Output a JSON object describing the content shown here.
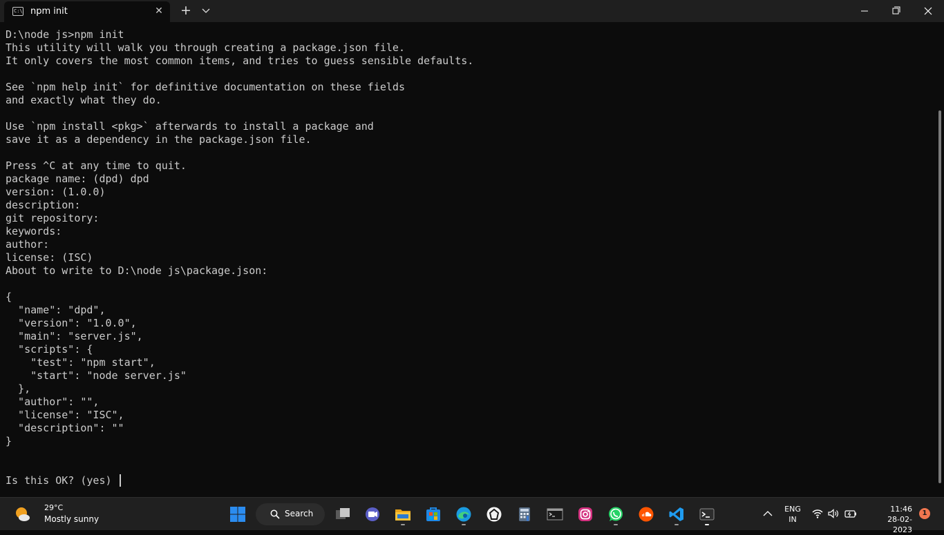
{
  "window": {
    "tab_title": "npm init",
    "tab_icon_text": "C:\\_",
    "close_tab_glyph": "✕",
    "new_tab_glyph": "+"
  },
  "terminal": {
    "lines": [
      "D:\\node js>npm init",
      "This utility will walk you through creating a package.json file.",
      "It only covers the most common items, and tries to guess sensible defaults.",
      "",
      "See `npm help init` for definitive documentation on these fields",
      "and exactly what they do.",
      "",
      "Use `npm install <pkg>` afterwards to install a package and",
      "save it as a dependency in the package.json file.",
      "",
      "Press ^C at any time to quit.",
      "package name: (dpd) dpd",
      "version: (1.0.0)",
      "description:",
      "git repository:",
      "keywords:",
      "author:",
      "license: (ISC)",
      "About to write to D:\\node js\\package.json:",
      "",
      "{",
      "  \"name\": \"dpd\",",
      "  \"version\": \"1.0.0\",",
      "  \"main\": \"server.js\",",
      "  \"scripts\": {",
      "    \"test\": \"npm start\",",
      "    \"start\": \"node server.js\"",
      "  },",
      "  \"author\": \"\",",
      "  \"license\": \"ISC\",",
      "  \"description\": \"\"",
      "}"
    ],
    "prompt": "Is this OK? (yes) "
  },
  "taskbar": {
    "weather": {
      "temp": "29°C",
      "desc": "Mostly sunny",
      "icon": "sun-cloud-icon"
    },
    "search_label": "Search",
    "apps": [
      "start-icon",
      "task-view-icon",
      "chat-icon",
      "file-explorer-icon",
      "store-icon",
      "edge-icon",
      "app-icon",
      "calculator-icon",
      "command-prompt-icon",
      "instagram-icon",
      "whatsapp-icon",
      "soundcloud-icon",
      "vscode-icon",
      "terminal-icon"
    ],
    "lang_line1": "ENG",
    "lang_line2": "IN",
    "time": "11:46",
    "date": "28-02-2023",
    "notification_count": "1"
  },
  "colors": {
    "terminal_bg": "#0c0c0c",
    "terminal_text": "#cccccc",
    "taskbar_bg": "#202020",
    "accent_blue": "#0078d4"
  }
}
